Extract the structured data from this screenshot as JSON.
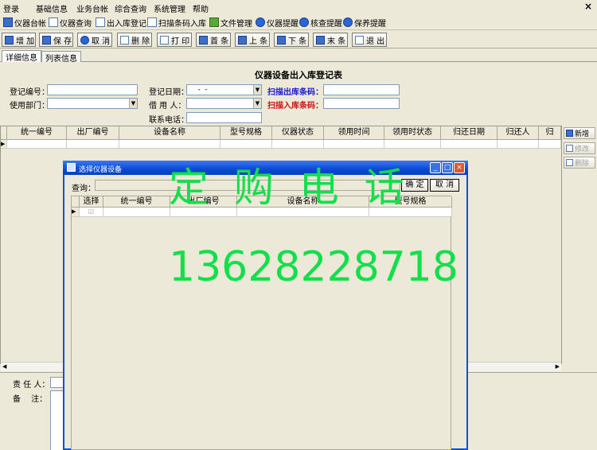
{
  "menubar": {
    "items": [
      "登录",
      "基础信息",
      "业务台帐",
      "综合查询",
      "系统管理",
      "帮助"
    ],
    "close_label": "×"
  },
  "navbar": {
    "items": [
      {
        "label": "仪器台帐",
        "icon": "ledger-icon"
      },
      {
        "label": "仪器查询",
        "icon": "query-icon"
      },
      {
        "label": "出入库登记",
        "icon": "stock-register-icon"
      },
      {
        "label": "扫描条码入库",
        "icon": "barcode-scan-icon"
      },
      {
        "label": "文件管理",
        "icon": "file-manage-icon"
      },
      {
        "label": "仪器提醒",
        "icon": "instrument-reminder-icon"
      },
      {
        "label": "核查提醒",
        "icon": "check-reminder-icon"
      },
      {
        "label": "保养提醒",
        "icon": "maintenance-reminder-icon"
      }
    ]
  },
  "toolbar": {
    "buttons": [
      {
        "label": "增 加",
        "icon": "add-icon"
      },
      {
        "label": "保 存",
        "icon": "save-icon"
      },
      {
        "label": "取 消",
        "icon": "undo-icon"
      },
      {
        "label": "删 除",
        "icon": "delete-icon"
      },
      {
        "label": "打 印",
        "icon": "print-icon"
      },
      {
        "label": "首 条",
        "icon": "first-record-icon"
      },
      {
        "label": "上 条",
        "icon": "prev-record-icon"
      },
      {
        "label": "下 条",
        "icon": "next-record-icon"
      },
      {
        "label": "末 条",
        "icon": "last-record-icon"
      },
      {
        "label": "退 出",
        "icon": "exit-icon"
      }
    ]
  },
  "tabs": [
    "详细信息",
    "列表信息"
  ],
  "form": {
    "title": "仪器设备出入库登记表",
    "reg_no_label": "登记编号：",
    "reg_no_value": "",
    "dept_label": "使用部门：",
    "dept_value": "",
    "reg_date_label": "登记日期：",
    "reg_date_value": "    -  -",
    "borrower_label": "借 用 人：",
    "borrower_value": "",
    "phone_label": "联系电话：",
    "phone_value": "",
    "scan_out_label": "扫描出库条码：",
    "scan_out_value": "",
    "scan_in_label": "扫描入库条码：",
    "scan_in_value": ""
  },
  "grid": {
    "columns": [
      "统一编号",
      "出厂编号",
      "设备名称",
      "型号规格",
      "仪器状态",
      "领用时间",
      "领用时状态",
      "归还日期",
      "归还人",
      "归"
    ]
  },
  "side_buttons": [
    {
      "label": "新增",
      "icon": "new-row-icon",
      "enabled": true
    },
    {
      "label": "修改",
      "icon": "edit-row-icon",
      "enabled": false
    },
    {
      "label": "删除",
      "icon": "delete-row-icon",
      "enabled": false
    }
  ],
  "bottom": {
    "owner_label": "责 任 人：",
    "owner_value": "",
    "note_label": "备　 注："
  },
  "dialog": {
    "title": "选择仪器设备",
    "query_label": "查询：",
    "query_value": "",
    "ok_label": "确 定",
    "cancel_label": "取 消",
    "columns": [
      "选择",
      "统一编号",
      "出厂编号",
      "设备名称",
      "型号规格"
    ]
  },
  "watermark": {
    "line1": "定 购 电 话",
    "line2": "13628228718"
  },
  "colors": {
    "dialog_titlebar": "#0a4ad4",
    "watermark": "#12e04b",
    "scan_out_label": "#1a1acc",
    "scan_in_label": "#cc1111"
  }
}
